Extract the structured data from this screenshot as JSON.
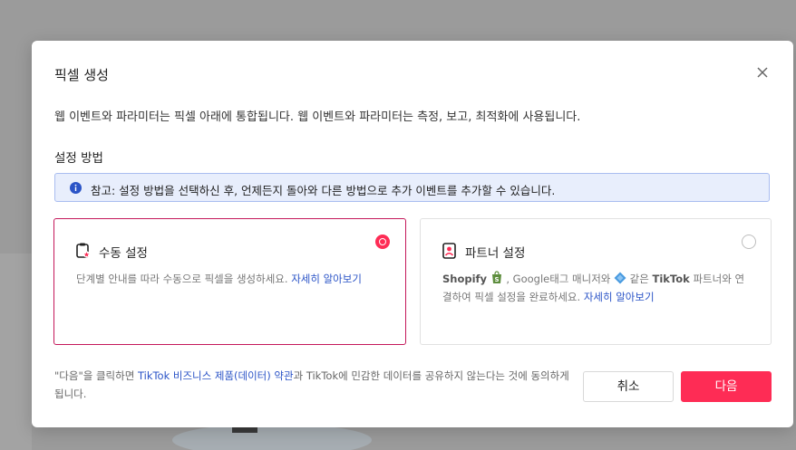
{
  "modal": {
    "title": "픽셀 생성",
    "description": "웹 이벤트와 파라미터는 픽셀 아래에 통합됩니다. 웹 이벤트와 파라미터는 측정, 보고, 최적화에 사용됩니다.",
    "close_icon": "close-icon"
  },
  "setup": {
    "section_title": "설정 방법",
    "notice": "참고: 설정 방법을 선택하신 후, 언제든지 돌아와 다른 방법으로 추가 이벤트를 추가할 수 있습니다.",
    "notice_icon": "info-icon",
    "options": [
      {
        "title": "수동 설정",
        "icon": "manual-setup-icon",
        "description": "단계별 안내를 따라 수동으로 픽셀을 생성하세요.",
        "link": "자세히 알아보기",
        "selected": true
      },
      {
        "title": "파트너 설정",
        "icon": "partner-setup-icon",
        "brand_shopify": "Shopify",
        "shopify_icon": "shopify-bag-icon",
        "text_mid": ", Google태그 매니저와",
        "tag_manager_icon": "tag-manager-diamond-icon",
        "text_after": "같은",
        "brand_tiktok": "TikTok",
        "text_tail": "파트너와 연결하여 픽셀 설정을 완료하세요.",
        "link": "자세히 알아보기",
        "selected": false
      }
    ]
  },
  "footer": {
    "note_prefix": "\"다음\"을 클릭하면",
    "terms_link": "TikTok 비즈니스 제품(데이터) 약관",
    "note_suffix": "과 TikTok에 민감한 데이터를 공유하지 않는다는 것에 동의하게 됩니다.",
    "cancel_label": "취소",
    "next_label": "다음"
  },
  "colors": {
    "accent": "#fe2c55",
    "selected_border": "#c4185a",
    "link": "#2b54c7",
    "notice_bg": "#e8eefc",
    "notice_border": "#a9bdf0",
    "overlay": "#9a9a9a"
  }
}
